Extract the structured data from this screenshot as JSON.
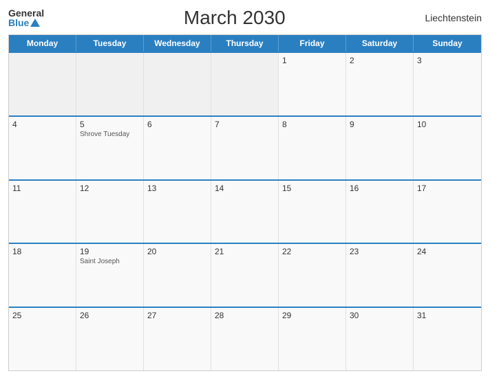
{
  "header": {
    "logo_general": "General",
    "logo_blue": "Blue",
    "title": "March 2030",
    "country": "Liechtenstein"
  },
  "days": {
    "headers": [
      "Monday",
      "Tuesday",
      "Wednesday",
      "Thursday",
      "Friday",
      "Saturday",
      "Sunday"
    ]
  },
  "weeks": [
    {
      "cells": [
        {
          "num": "",
          "holiday": "",
          "empty": true
        },
        {
          "num": "",
          "holiday": "",
          "empty": true
        },
        {
          "num": "",
          "holiday": "",
          "empty": true
        },
        {
          "num": "",
          "holiday": "",
          "empty": true
        },
        {
          "num": "1",
          "holiday": ""
        },
        {
          "num": "2",
          "holiday": ""
        },
        {
          "num": "3",
          "holiday": ""
        }
      ]
    },
    {
      "cells": [
        {
          "num": "4",
          "holiday": ""
        },
        {
          "num": "5",
          "holiday": "Shrove Tuesday"
        },
        {
          "num": "6",
          "holiday": ""
        },
        {
          "num": "7",
          "holiday": ""
        },
        {
          "num": "8",
          "holiday": ""
        },
        {
          "num": "9",
          "holiday": ""
        },
        {
          "num": "10",
          "holiday": ""
        }
      ]
    },
    {
      "cells": [
        {
          "num": "11",
          "holiday": ""
        },
        {
          "num": "12",
          "holiday": ""
        },
        {
          "num": "13",
          "holiday": ""
        },
        {
          "num": "14",
          "holiday": ""
        },
        {
          "num": "15",
          "holiday": ""
        },
        {
          "num": "16",
          "holiday": ""
        },
        {
          "num": "17",
          "holiday": ""
        }
      ]
    },
    {
      "cells": [
        {
          "num": "18",
          "holiday": ""
        },
        {
          "num": "19",
          "holiday": "Saint Joseph"
        },
        {
          "num": "20",
          "holiday": ""
        },
        {
          "num": "21",
          "holiday": ""
        },
        {
          "num": "22",
          "holiday": ""
        },
        {
          "num": "23",
          "holiday": ""
        },
        {
          "num": "24",
          "holiday": ""
        }
      ]
    },
    {
      "cells": [
        {
          "num": "25",
          "holiday": ""
        },
        {
          "num": "26",
          "holiday": ""
        },
        {
          "num": "27",
          "holiday": ""
        },
        {
          "num": "28",
          "holiday": ""
        },
        {
          "num": "29",
          "holiday": ""
        },
        {
          "num": "30",
          "holiday": ""
        },
        {
          "num": "31",
          "holiday": ""
        }
      ]
    }
  ]
}
